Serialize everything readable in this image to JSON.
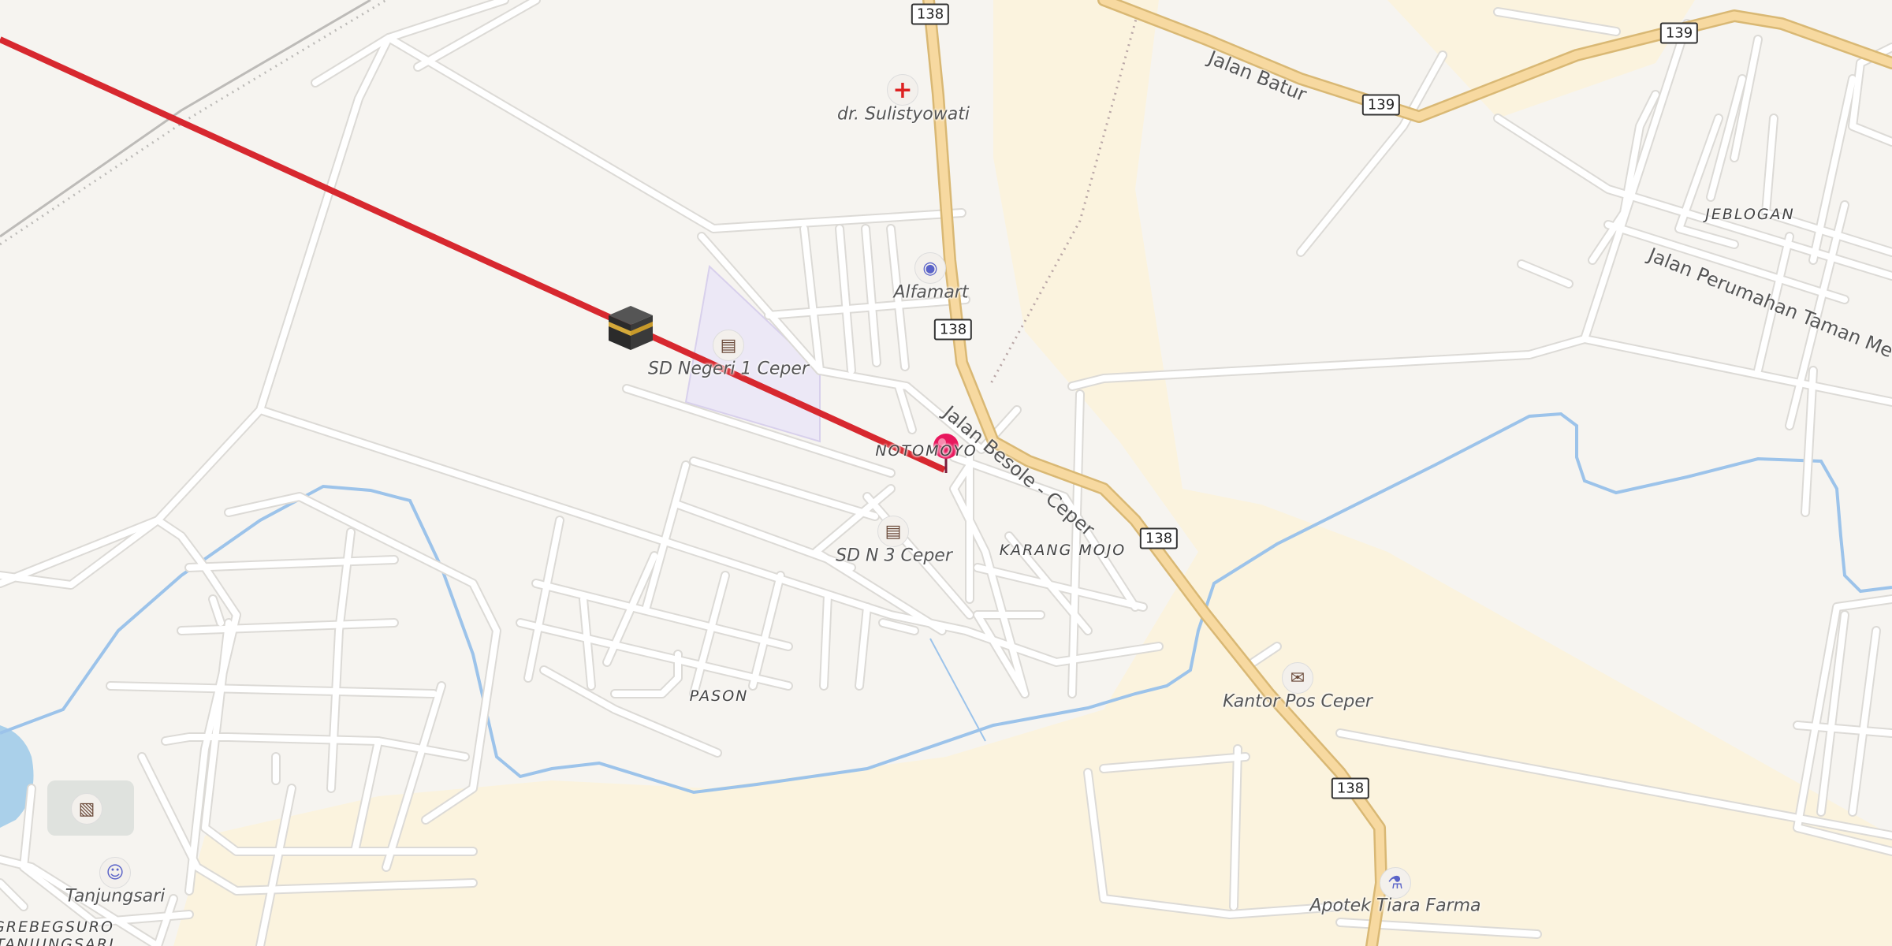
{
  "routes": [
    {
      "number": "138"
    },
    {
      "number": "138"
    },
    {
      "number": "138"
    },
    {
      "number": "138"
    },
    {
      "number": "139"
    },
    {
      "number": "139"
    }
  ],
  "streets": {
    "jalan_batur": "Jalan Batur",
    "jalan_besole": "Jalan Besole - Ceper",
    "jalan_perumahan": "Jalan Perumahan Taman Me"
  },
  "places": {
    "notomoyo": "NOTOMOYO",
    "karang_mojo": "KARANG MOJO",
    "pason": "PASON",
    "jeblogan": "JEBLOGAN",
    "grebegsuro": "GREBEGSURO",
    "tanjungsari_area": "TANJUNGSARI"
  },
  "pois": {
    "doctor": "dr. Sulistyowati",
    "alfamart": "Alfamart",
    "sd_negeri": "SD Negeri 1 Ceper",
    "sd_n3": "SD N 3 Ceper",
    "kantor_pos": "Kantor Pos Ceper",
    "apotek": "Apotek Tiara Farma",
    "tanjungsari": "Tanjungsari"
  },
  "colors": {
    "background": "#f6f4f0",
    "road": "#ffffff",
    "road_casing": "#dcdad6",
    "highway": "#f7d9a0",
    "highway_casing": "#d9b874",
    "river": "#9cc3ea",
    "qibla_line": "#d7282f",
    "pin": "#e8175d",
    "school_area": "#ece8f6",
    "farmland": "#fbf3de"
  },
  "icons": {
    "qibla": "kaaba-icon",
    "pin": "location-pin-icon"
  }
}
